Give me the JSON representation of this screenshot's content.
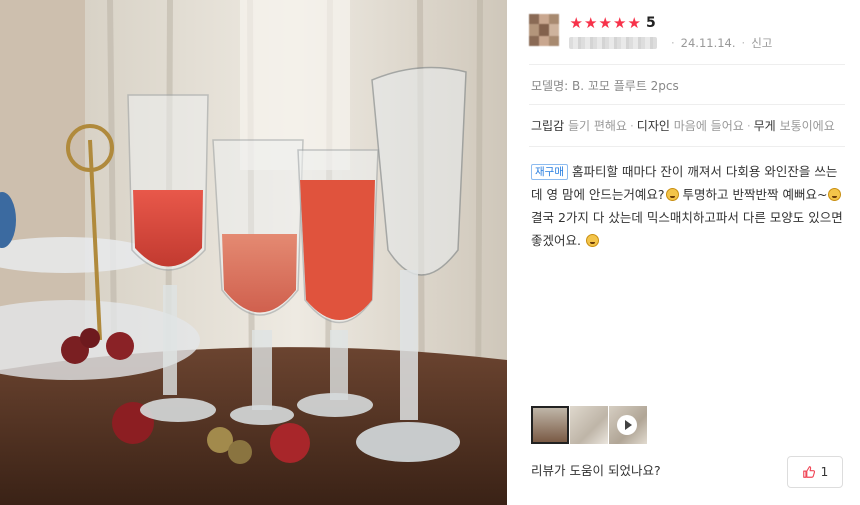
{
  "review": {
    "rating": "5",
    "stars": [
      "★",
      "★",
      "★",
      "★",
      "★"
    ],
    "date": "24.11.14.",
    "report_label": "신고",
    "model_label": "모델명: B. 꼬모 플루트 2pcs",
    "attributes": [
      {
        "key": "그립감",
        "value": "들기 편해요"
      },
      {
        "key": "디자인",
        "value": "마음에 들어요"
      },
      {
        "key": "무게",
        "value": "보통이에요"
      }
    ],
    "badge": "재구매",
    "text_1": "홈파티할 때마다 잔이 깨져서 다회용 와인잔을 쓰는데 영 맘에 안드는거예요?",
    "text_2": " 투명하고 반짝반짝 예뻐요~",
    "text_3": " 결국 2가지 다 샀는데 믹스매치하고파서 다른 모양도 있으면 좋겠어요.",
    "helpful_question": "리뷰가 도움이 되었나요?",
    "like_count": "1"
  },
  "icons": {
    "star": "star-icon",
    "emoji": "smiley-emoji-icon",
    "play": "play-icon",
    "like": "thumbs-up-icon"
  },
  "colors": {
    "star": "#f7324a",
    "badge": "#2a7fe0"
  }
}
